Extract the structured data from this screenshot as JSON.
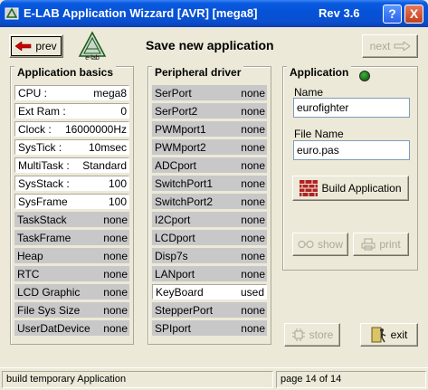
{
  "window": {
    "title": "E-LAB Application Wizzard [AVR] [mega8]",
    "revision": "Rev 3.6",
    "help_label": "?",
    "close_label": "X"
  },
  "toolbar": {
    "prev_label": "prev",
    "next_label": "next",
    "page_title": "Save new application",
    "logo_text": "e-lab"
  },
  "basics": {
    "title": "Application basics",
    "rows": [
      {
        "label": "CPU :",
        "value": "mega8"
      },
      {
        "label": "Ext Ram :",
        "value": "0"
      },
      {
        "label": "Clock :",
        "value": "16000000Hz"
      },
      {
        "label": "SysTick :",
        "value": "10msec"
      },
      {
        "label": "MultiTask :",
        "value": "Standard"
      },
      {
        "label": "SysStack :",
        "value": "100"
      },
      {
        "label": "SysFrame",
        "value": "100"
      },
      {
        "label": "TaskStack",
        "value": "none"
      },
      {
        "label": "TaskFrame",
        "value": "none"
      },
      {
        "label": "Heap",
        "value": "none"
      },
      {
        "label": "RTC",
        "value": "none"
      },
      {
        "label": "LCD Graphic",
        "value": "none"
      },
      {
        "label": "File Sys Size",
        "value": "none"
      },
      {
        "label": "UserDatDevice",
        "value": "none"
      }
    ]
  },
  "peripheral": {
    "title": "Peripheral driver",
    "rows": [
      {
        "label": "SerPort",
        "value": "none"
      },
      {
        "label": "SerPort2",
        "value": "none"
      },
      {
        "label": "PWMport1",
        "value": "none"
      },
      {
        "label": "PWMport2",
        "value": "none"
      },
      {
        "label": "ADCport",
        "value": "none"
      },
      {
        "label": "SwitchPort1",
        "value": "none"
      },
      {
        "label": "SwitchPort2",
        "value": "none"
      },
      {
        "label": "I2Cport",
        "value": "none"
      },
      {
        "label": "LCDport",
        "value": "none"
      },
      {
        "label": "Disp7s",
        "value": "none"
      },
      {
        "label": "LANport",
        "value": "none"
      },
      {
        "label": "KeyBoard",
        "value": "used"
      },
      {
        "label": "StepperPort",
        "value": "none"
      },
      {
        "label": "SPIport",
        "value": "none"
      }
    ]
  },
  "application": {
    "title": "Application",
    "name_label": "Name",
    "name_value": "eurofighter",
    "filename_label": "File Name",
    "filename_value": "euro.pas",
    "build_label": "Build Application",
    "show_label": "show",
    "print_label": "print",
    "store_label": "store",
    "exit_label": "exit"
  },
  "status": {
    "left": "build temporary Application",
    "right": "page 14 of 14"
  },
  "colors": {
    "face": "#ece9d8",
    "titlebar": "#0553d8",
    "row_off": "#c8c8c8",
    "led": "#1a7a1a",
    "build_icon": "#b22222"
  }
}
